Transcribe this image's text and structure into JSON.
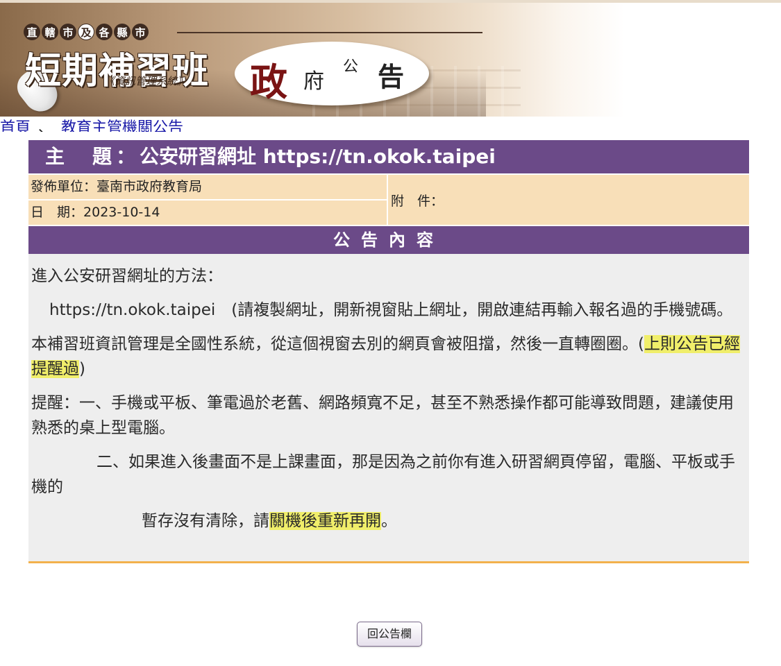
{
  "banner": {
    "subtitle_chars": [
      "直",
      "轄",
      "市",
      "及",
      "各",
      "縣",
      "市"
    ],
    "title": "短期補習班",
    "system_name": "《資訊管理系統》",
    "gov_chars": [
      "政",
      "府",
      "公",
      "告"
    ]
  },
  "breadcrumb": {
    "home": "首頁",
    "separator": "、",
    "section": "教育主管機關公告"
  },
  "announcement": {
    "subject_label": "主　題：",
    "subject": "公安研習網址 https://tn.okok.taipei",
    "publisher_label": "發佈單位：",
    "publisher": "臺南市政府教育局",
    "date_label": "日　期：",
    "date": "2023-10-14",
    "attachment_label": "附　件：",
    "content_header": "公告內容",
    "content": {
      "p1": "進入公安研習網址的方法：",
      "p2": "https://tn.okok.taipei　(請複製網址，開新視窗貼上網址，開啟連結再輸入報名過的手機號碼。",
      "p3_a": "本補習班資訊管理是全國性系統，從這個視窗去別的網頁會被阻擋，然後一直轉圈圈。(",
      "p3_hl": "上則公告已經提醒過",
      "p3_b": ")",
      "p4": "提醒：一、手機或平板、筆電過於老舊、網路頻寬不足，甚至不熟悉操作都可能導致問題，建議使用熟悉的桌上型電腦。",
      "p5": "二、如果進入後畫面不是上課畫面，那是因為之前你有進入研習網頁停留，電腦、平板或手機的",
      "p6_a": "暫存沒有清除，請",
      "p6_hl": "關機後重新再開",
      "p6_b": "。"
    }
  },
  "back_button": "回公告欄",
  "colors": {
    "purple_bar": "#6b4a88",
    "meta_bg": "#f8dfb8",
    "content_bg": "#eeeeee",
    "highlight": "#f0ee6a",
    "gov_red": "#7a1414",
    "link": "#1a1aa8"
  }
}
